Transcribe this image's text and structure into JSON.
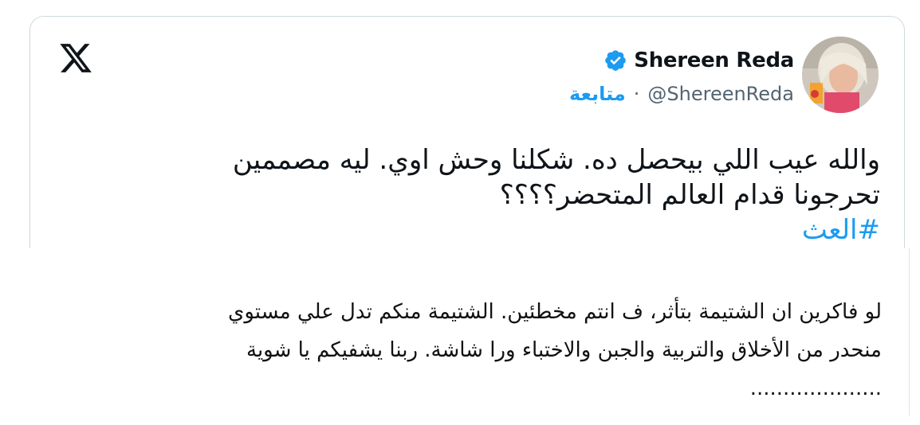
{
  "tweet": {
    "author_name": "Shereen Reda",
    "author_handle": "@ShereenReda",
    "separator": "·",
    "follow_label": "متابعة",
    "text_lines": [
      "والله عيب اللي بيحصل ده. شكلنا وحش اوي. ليه مصممين",
      "تحرجونا قدام العالم المتحضر؟؟؟؟"
    ],
    "hashtag": "#العث"
  },
  "reply": {
    "lines": [
      "لو  فاكرين ان الشتيمة بتأثر، ف انتم مخطئين. الشتيمة منكم تدل علي مستوي",
      "منحدر من الأخلاق والتربية والجبن والاختباء ورا شاشة. ربنا يشفيكم يا شوية",
      "...................."
    ]
  },
  "colors": {
    "accent": "#1d9bf0",
    "text": "#0f1419",
    "muted": "#536471",
    "border": "#cfd9de"
  },
  "icons": {
    "logo": "x-logo-icon",
    "verified": "verified-badge-icon"
  }
}
